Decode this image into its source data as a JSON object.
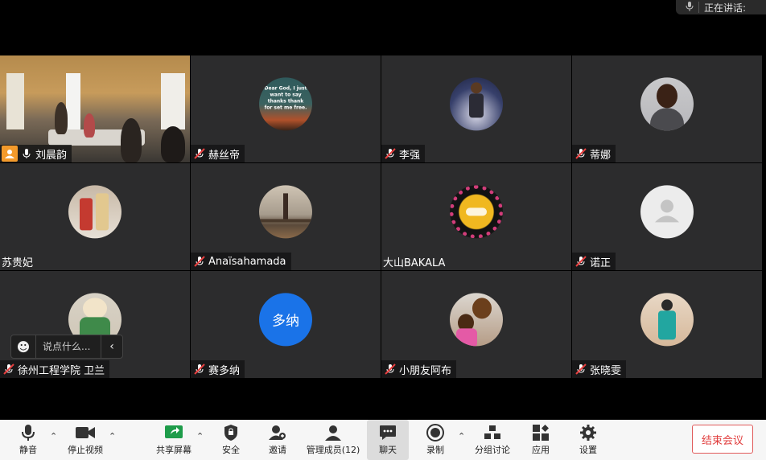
{
  "speaking": {
    "label": "正在讲话:"
  },
  "tiles": [
    {
      "name": "刘晨韵",
      "type": "video"
    },
    {
      "name": "赫丝帝",
      "avatar_text": "Dear God, I just want to say thanks thank for set me free."
    },
    {
      "name": "李强"
    },
    {
      "name": "蒂娜"
    },
    {
      "name": "苏贵妃"
    },
    {
      "name": "Anaïsahamada"
    },
    {
      "name": "大山BAKALA"
    },
    {
      "name": "诺正"
    },
    {
      "name": "徐州工程学院 卫兰"
    },
    {
      "name": "赛多纳",
      "avatar_text": "多纳"
    },
    {
      "name": "小朋友阿布"
    },
    {
      "name": "张晓雯"
    }
  ],
  "chat_input": {
    "placeholder": "说点什么..."
  },
  "toolbar": {
    "mute": "静音",
    "stop_video": "停止视频",
    "share": "共享屏幕",
    "security": "安全",
    "invite": "邀请",
    "participants": "管理成员(12)",
    "chat": "聊天",
    "record": "录制",
    "breakout": "分组讨论",
    "apps": "应用",
    "settings": "设置",
    "end": "结束会议"
  },
  "colors": {
    "host_badge": "#f39a2b",
    "end_red": "#e03c3c",
    "avatar_blue": "#1a73e8"
  }
}
